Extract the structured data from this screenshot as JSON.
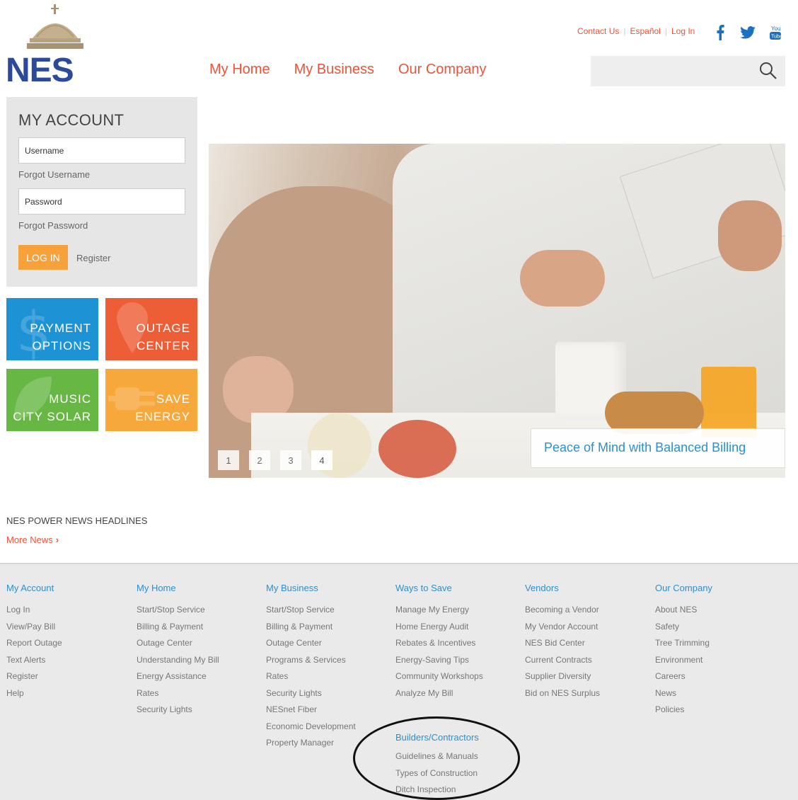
{
  "brand": {
    "logo_text": "NES"
  },
  "nav": {
    "items": [
      "My Home",
      "My Business",
      "Our Company"
    ]
  },
  "toplinks": {
    "contact": "Contact Us",
    "espanol": "Español",
    "login": "Log In"
  },
  "social": {
    "facebook": "facebook-icon",
    "twitter": "twitter-icon",
    "youtube": "youtube-icon"
  },
  "search": {
    "placeholder": ""
  },
  "account": {
    "title": "MY ACCOUNT",
    "username_placeholder": "Username",
    "forgot_username": "Forgot Username",
    "password_placeholder": "Password",
    "forgot_password": "Forgot Password",
    "login_button": "LOG IN",
    "register": "Register"
  },
  "tiles": [
    {
      "line1": "PAYMENT",
      "line2": "OPTIONS",
      "color": "#1d93d5"
    },
    {
      "line1": "OUTAGE",
      "line2": "CENTER",
      "color": "#ed5d36"
    },
    {
      "line1": "MUSIC",
      "line2": "CITY SOLAR",
      "color": "#67b744"
    },
    {
      "line1": "SAVE",
      "line2": "ENERGY",
      "color": "#f7a83a"
    }
  ],
  "hero": {
    "caption": "Peace of Mind with Balanced Billing",
    "slides": [
      "1",
      "2",
      "3",
      "4"
    ],
    "active_slide": 4
  },
  "news": {
    "title": "NES POWER NEWS HEADLINES",
    "more": "More News"
  },
  "footer": {
    "columns": [
      {
        "head": "My Account",
        "items": [
          "Log In",
          "View/Pay Bill",
          "Report Outage",
          "Text Alerts",
          "Register",
          "Help"
        ]
      },
      {
        "head": "My Home",
        "items": [
          "Start/Stop Service",
          "Billing & Payment",
          "Outage Center",
          "Understanding My Bill",
          "Energy Assistance",
          "Rates",
          "Security Lights"
        ]
      },
      {
        "head": "My Business",
        "items": [
          "Start/Stop Service",
          "Billing & Payment",
          "Outage Center",
          "Programs & Services",
          "Rates",
          "Security Lights",
          "NESnet Fiber",
          "Economic Development",
          "Property Manager"
        ]
      },
      {
        "head": "Ways to Save",
        "items": [
          "Manage My Energy",
          "Home Energy Audit",
          "Rebates & Incentives",
          "Energy-Saving Tips",
          "Community Workshops",
          "Analyze My Bill"
        ]
      },
      {
        "head": "Vendors",
        "items": [
          "Becoming a Vendor",
          "My Vendor Account",
          "NES Bid Center",
          "Current Contracts",
          "Supplier Diversity",
          "Bid on NES Surplus"
        ]
      },
      {
        "head": "Our Company",
        "items": [
          "About NES",
          "Safety",
          "Tree Trimming",
          "Environment",
          "Careers",
          "News",
          "Policies"
        ]
      }
    ],
    "builders": {
      "head": "Builders/Contractors",
      "items": [
        "Guidelines & Manuals",
        "Types of Construction",
        "Ditch Inspection"
      ]
    }
  },
  "colors": {
    "accent_orange": "#e8553a",
    "link_blue": "#2e8fcb",
    "brand_blue": "#2d4a9a"
  }
}
